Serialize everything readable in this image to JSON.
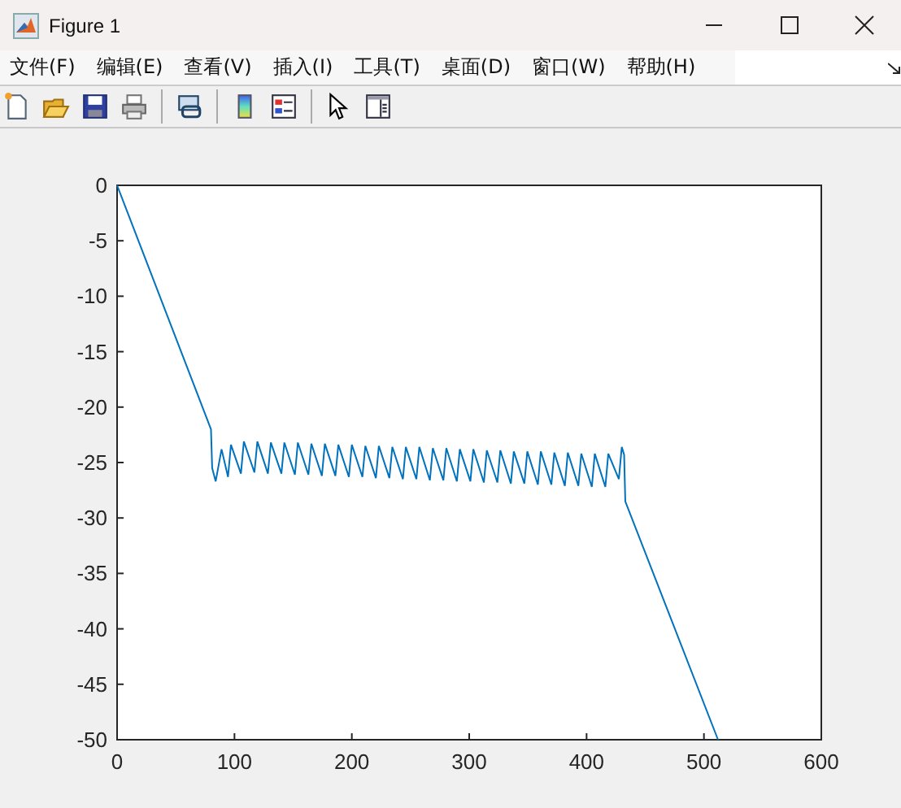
{
  "window": {
    "title": "Figure 1"
  },
  "menu": [
    {
      "label": "文件(F)"
    },
    {
      "label": "编辑(E)"
    },
    {
      "label": "查看(V)"
    },
    {
      "label": "插入(I)"
    },
    {
      "label": "工具(T)"
    },
    {
      "label": "桌面(D)"
    },
    {
      "label": "窗口(W)"
    },
    {
      "label": "帮助(H)"
    }
  ],
  "plot": {
    "chart_data": {
      "type": "line",
      "xlim": [
        0,
        600
      ],
      "ylim": [
        -50,
        0
      ],
      "xticks": [
        0,
        100,
        200,
        300,
        400,
        500,
        600
      ],
      "yticks": [
        0,
        -5,
        -10,
        -15,
        -20,
        -25,
        -30,
        -35,
        -40,
        -45,
        -50
      ],
      "x": [
        0,
        80,
        81,
        84,
        89,
        94.5,
        97,
        105.5,
        108,
        117,
        119.5,
        128.5,
        131,
        140,
        142.5,
        151.5,
        154,
        163,
        165.5,
        174.5,
        177,
        186,
        188.5,
        197.5,
        200,
        209,
        211.5,
        220.5,
        223,
        232,
        234.5,
        243.5,
        246,
        255,
        257.5,
        266.5,
        269,
        278,
        280.5,
        289.5,
        292,
        301,
        303.5,
        312.5,
        315,
        324,
        326.5,
        335.5,
        338,
        347,
        349.5,
        358.5,
        361,
        370,
        372.5,
        381.5,
        384,
        393,
        395.5,
        404.5,
        407,
        416,
        418.5,
        427.5,
        430,
        432,
        433,
        512
      ],
      "series": [
        {
          "color": "#0072bd",
          "values": [
            0,
            -22,
            -25.5,
            -26.7,
            -23.8,
            -26.3,
            -23.4,
            -26.0,
            -23.1,
            -25.9,
            -23.1,
            -26.0,
            -23.2,
            -26.0,
            -23.2,
            -26.1,
            -23.2,
            -26.1,
            -23.3,
            -26.2,
            -23.3,
            -26.2,
            -23.4,
            -26.3,
            -23.4,
            -26.3,
            -23.5,
            -26.4,
            -23.5,
            -26.4,
            -23.6,
            -26.5,
            -23.6,
            -26.5,
            -23.6,
            -26.6,
            -23.7,
            -26.6,
            -23.7,
            -26.7,
            -23.8,
            -26.7,
            -23.8,
            -26.8,
            -23.9,
            -26.8,
            -23.9,
            -26.9,
            -24.0,
            -26.9,
            -24.0,
            -27.0,
            -24.0,
            -27.0,
            -24.1,
            -27.1,
            -24.1,
            -27.1,
            -24.2,
            -27.2,
            -24.2,
            -27.2,
            -24.2,
            -26.5,
            -23.6,
            -24.3,
            -28.5,
            -50
          ]
        }
      ]
    }
  }
}
